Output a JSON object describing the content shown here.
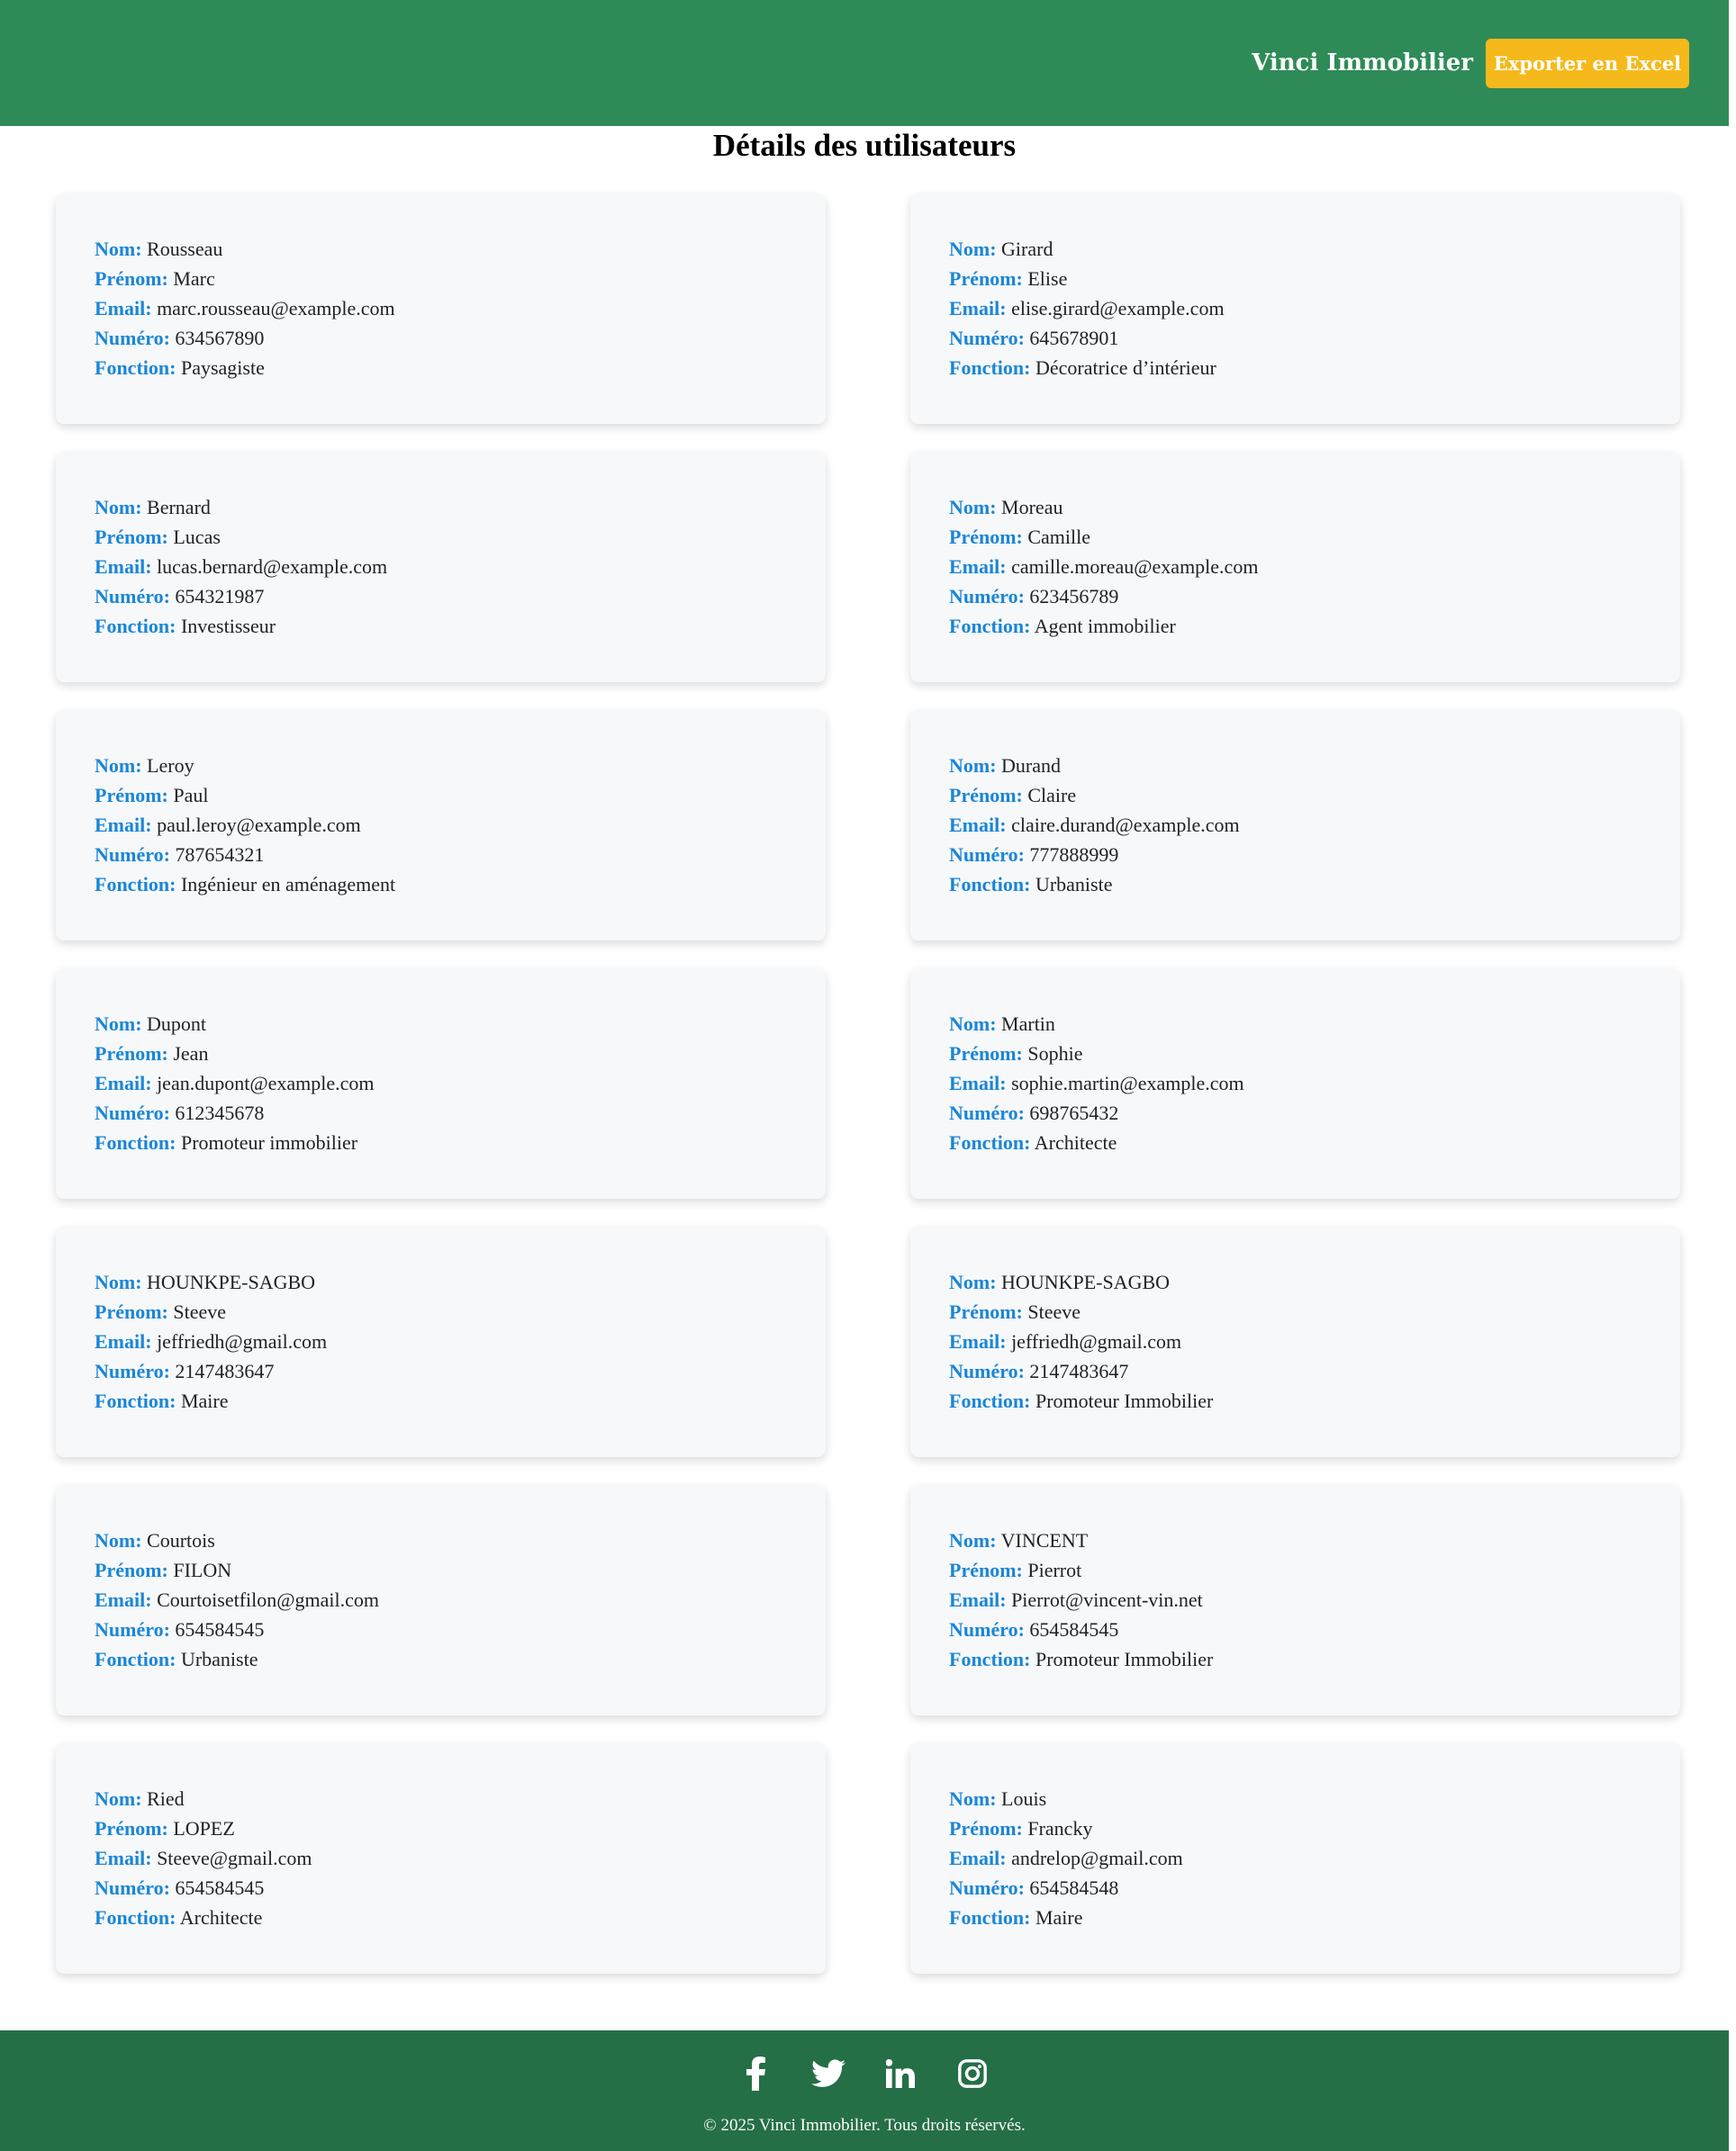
{
  "header": {
    "brand": "Vinci Immobilier",
    "export_label": "Exporter en Excel"
  },
  "page_title": "Détails des utilisateurs",
  "labels": {
    "nom": "Nom:",
    "prenom": "Prénom:",
    "email": "Email:",
    "numero": "Numéro:",
    "fonction": "Fonction:"
  },
  "users": [
    {
      "nom": "Rousseau",
      "prenom": "Marc",
      "email": "marc.rousseau@example.com",
      "numero": "634567890",
      "fonction": "Paysagiste"
    },
    {
      "nom": "Girard",
      "prenom": "Elise",
      "email": "elise.girard@example.com",
      "numero": "645678901",
      "fonction": "Décoratrice d’intérieur"
    },
    {
      "nom": "Bernard",
      "prenom": "Lucas",
      "email": "lucas.bernard@example.com",
      "numero": "654321987",
      "fonction": "Investisseur"
    },
    {
      "nom": "Moreau",
      "prenom": "Camille",
      "email": "camille.moreau@example.com",
      "numero": "623456789",
      "fonction": "Agent immobilier"
    },
    {
      "nom": "Leroy",
      "prenom": "Paul",
      "email": "paul.leroy@example.com",
      "numero": "787654321",
      "fonction": "Ingénieur en aménagement"
    },
    {
      "nom": "Durand",
      "prenom": "Claire",
      "email": "claire.durand@example.com",
      "numero": "777888999",
      "fonction": "Urbaniste"
    },
    {
      "nom": "Dupont",
      "prenom": "Jean",
      "email": "jean.dupont@example.com",
      "numero": "612345678",
      "fonction": "Promoteur immobilier"
    },
    {
      "nom": "Martin",
      "prenom": "Sophie",
      "email": "sophie.martin@example.com",
      "numero": "698765432",
      "fonction": "Architecte"
    },
    {
      "nom": "HOUNKPE-SAGBO",
      "prenom": "Steeve",
      "email": "jeffriedh@gmail.com",
      "numero": "2147483647",
      "fonction": "Maire"
    },
    {
      "nom": "HOUNKPE-SAGBO",
      "prenom": "Steeve",
      "email": "jeffriedh@gmail.com",
      "numero": "2147483647",
      "fonction": "Promoteur Immobilier"
    },
    {
      "nom": "Courtois",
      "prenom": "FILON",
      "email": "Courtoisetfilon@gmail.com",
      "numero": "654584545",
      "fonction": "Urbaniste"
    },
    {
      "nom": "VINCENT",
      "prenom": "Pierrot",
      "email": "Pierrot@vincent-vin.net",
      "numero": "654584545",
      "fonction": "Promoteur Immobilier"
    },
    {
      "nom": "Ried",
      "prenom": "LOPEZ",
      "email": "Steeve@gmail.com",
      "numero": "654584545",
      "fonction": "Architecte"
    },
    {
      "nom": "Louis",
      "prenom": "Francky",
      "email": "andrelop@gmail.com",
      "numero": "654584548",
      "fonction": "Maire"
    }
  ],
  "footer": {
    "social_icons": [
      "facebook-icon",
      "twitter-icon",
      "linkedin-icon",
      "instagram-icon"
    ],
    "copyright": "© 2025 Vinci Immobilier. Tous droits réservés."
  },
  "colors": {
    "header_bg": "#2e8b57",
    "footer_bg": "#256f46",
    "button_bg": "#f6b91b",
    "label": "#1a86d6",
    "card_bg": "#f7f8fa"
  }
}
